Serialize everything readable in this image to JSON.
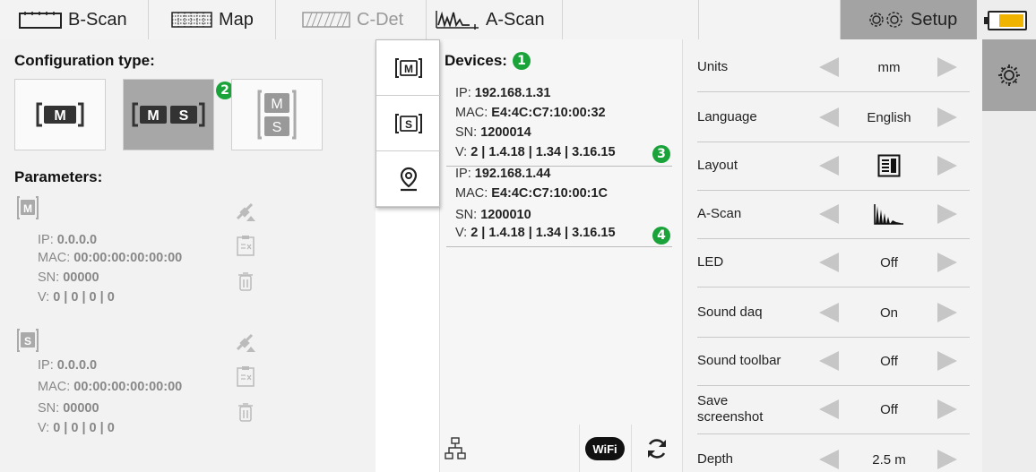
{
  "tabs": [
    {
      "label": "B-Scan",
      "icon": "bscan-icon"
    },
    {
      "label": "Map",
      "icon": "map-grid-icon"
    },
    {
      "label": "C-Det",
      "icon": "cdet-icon",
      "disabled": true
    },
    {
      "label": "A-Scan",
      "icon": "ascan-icon"
    },
    {
      "label": "Setup",
      "icon": "gears-icon",
      "active": true
    }
  ],
  "battery": {
    "level_fraction": 0.7,
    "color": "#f0b400"
  },
  "config": {
    "title": "Configuration type:",
    "options": [
      {
        "name": "M",
        "labels": [
          "M"
        ],
        "selected": false
      },
      {
        "name": "M S",
        "labels": [
          "M",
          "S"
        ],
        "selected": true
      },
      {
        "name": "M/S stacked",
        "labels": [
          "M",
          "S"
        ],
        "selected": false
      }
    ],
    "badge": "2"
  },
  "parameters": {
    "title": "Parameters:",
    "units": [
      {
        "tag": "M",
        "ip_label": "IP: ",
        "ip": "0.0.0.0",
        "mac_label": "MAC: ",
        "mac": "00:00:00:00:00:00",
        "sn_label": "SN: ",
        "sn": "00000",
        "v_label": "V: ",
        "v": "0 | 0 | 0 | 0"
      },
      {
        "tag": "S",
        "ip_label": "IP: ",
        "ip": "0.0.0.0",
        "mac_label": "MAC: ",
        "mac": "00:00:00:00:00:00",
        "sn_label": "SN: ",
        "sn": "00000",
        "v_label": "V: ",
        "v": "0 | 0 | 0 | 0"
      }
    ]
  },
  "popup": {
    "items": [
      {
        "label": "M",
        "icon": "m-unit-icon"
      },
      {
        "label": "S",
        "icon": "s-unit-icon"
      },
      {
        "icon": "location-pin-icon"
      }
    ]
  },
  "devices": {
    "title": "Devices:",
    "title_badge": "1",
    "list": [
      {
        "ip_label": "IP: ",
        "ip": "192.168.1.31",
        "mac_label": "MAC: ",
        "mac": "E4:4C:C7:10:00:32",
        "sn_label": "SN: ",
        "sn": "1200014",
        "v_label": "V: ",
        "v": "2 | 1.4.18 | 1.34 | 3.16.15",
        "badge": "3"
      },
      {
        "ip_label": "IP: ",
        "ip": "192.168.1.44",
        "mac_label": "MAC: ",
        "mac": "E4:4C:C7:10:00:1C",
        "sn_label": "SN: ",
        "sn": "1200010",
        "v_label": "V: ",
        "v": "2 | 1.4.18 | 1.34 | 3.16.15",
        "badge": "4"
      }
    ],
    "bottom_icons": [
      "network-icon",
      "wifi-icon",
      "refresh-icon"
    ],
    "wifi_label": "WiFi"
  },
  "settings": [
    {
      "label": "Units",
      "value": "mm"
    },
    {
      "label": "Language",
      "value": "English"
    },
    {
      "label": "Layout",
      "value_icon": "layout-icon"
    },
    {
      "label": "A-Scan",
      "value_icon": "ascan-waveform-icon"
    },
    {
      "label": "LED",
      "value": "Off"
    },
    {
      "label": "Sound daq",
      "value": "On"
    },
    {
      "label": "Sound toolbar",
      "value": "Off"
    },
    {
      "label": "Save\nscreenshot",
      "value": "Off"
    },
    {
      "label": "Depth",
      "value": "2.5 m"
    }
  ],
  "sidebar": {
    "icon": "settings-gear-icon"
  },
  "colors": {
    "badge_green": "#1aa33a",
    "selected_gray": "#a7a7a7",
    "arrow_gray": "#c6c6c6"
  }
}
